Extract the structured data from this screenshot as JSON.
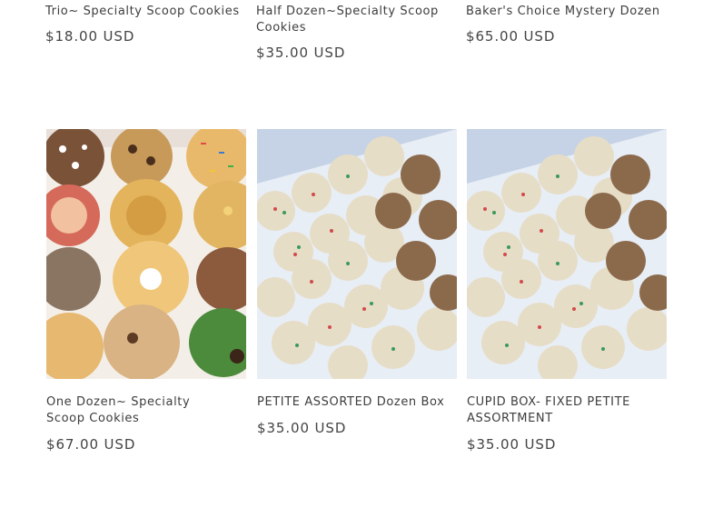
{
  "row1": [
    {
      "title": "Trio~ Specialty Scoop Cookies",
      "price": "$18.00 USD"
    },
    {
      "title": "Half Dozen~Specialty Scoop Cookies",
      "price": "$35.00 USD"
    },
    {
      "title": "Baker's Choice Mystery Dozen",
      "price": "$65.00 USD"
    }
  ],
  "row2": [
    {
      "title": "One Dozen~ Specialty Scoop Cookies",
      "price": "$67.00 USD",
      "image": "assorted-specialty-cookies-photo"
    },
    {
      "title": "PETITE ASSORTED Dozen Box",
      "price": "$35.00 USD",
      "image": "petite-assorted-cookies-photo"
    },
    {
      "title": "CUPID BOX- FIXED PETITE ASSORTMENT",
      "price": "$35.00 USD",
      "image": "cupid-petite-cookies-photo"
    }
  ]
}
